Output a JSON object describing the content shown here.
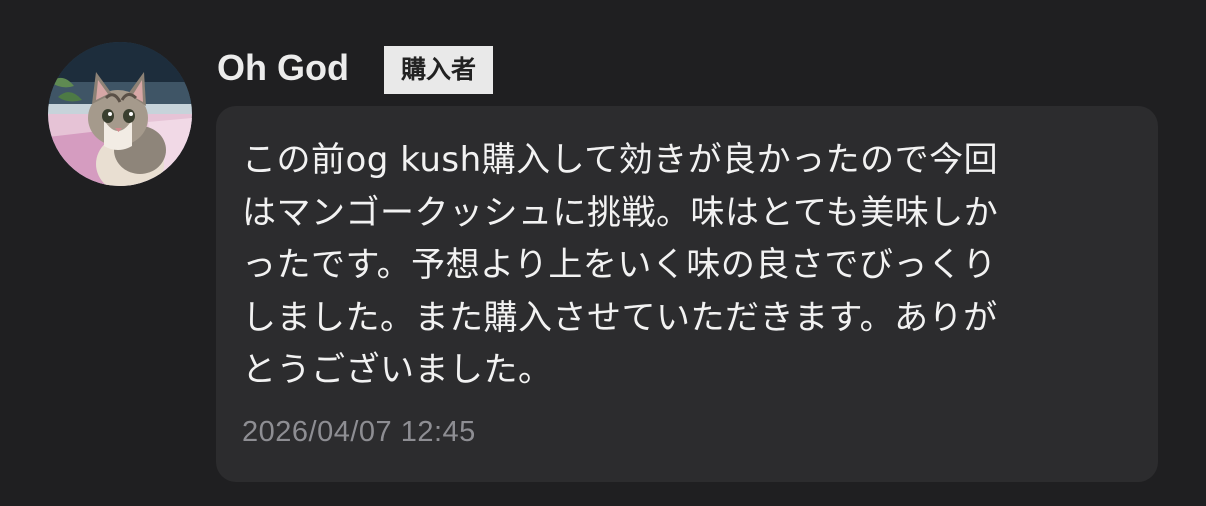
{
  "review": {
    "user": {
      "name": "Oh God",
      "badge": "購入者",
      "avatar_icon": "kitten-photo"
    },
    "comment_lines": [
      "この前og kush購入して効きが良かったので今回",
      "はマンゴークッシュに挑戦。味はとても美味しか",
      "ったです。予想より上をいく味の良さでびっくり",
      "しました。また購入させていただきます。ありが",
      "とうございました。"
    ],
    "timestamp": "2026/04/07 12:45"
  },
  "colors": {
    "background": "#1f1f21",
    "bubble": "#2c2c2e",
    "badge_background": "#e9e9e9",
    "timestamp_text": "#8e8e93"
  }
}
